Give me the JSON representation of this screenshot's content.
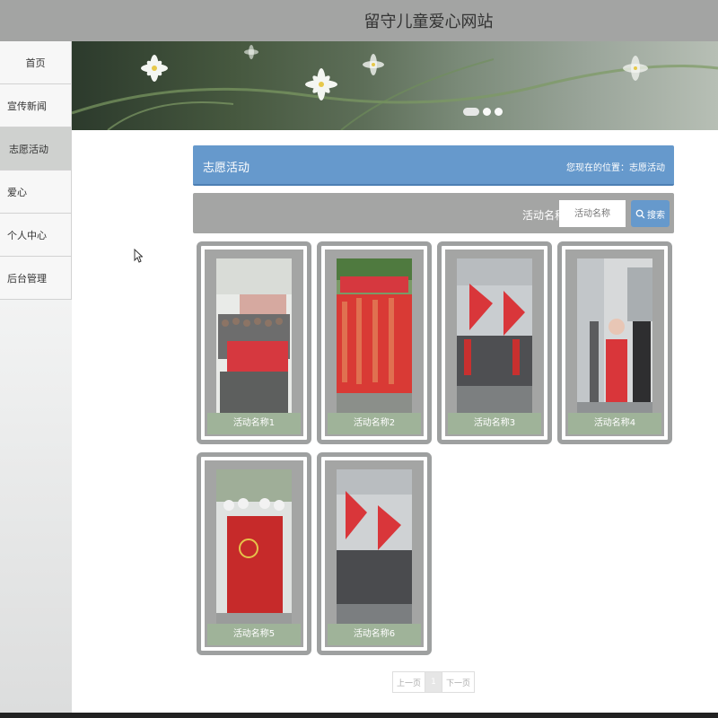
{
  "site": {
    "title": "留守儿童爱心网站"
  },
  "nav": {
    "items": [
      {
        "label": "首页"
      },
      {
        "label": "宣传新闻"
      },
      {
        "label": "志愿活动"
      },
      {
        "label": "爱心"
      },
      {
        "label": "个人中心"
      },
      {
        "label": "后台管理"
      }
    ]
  },
  "section": {
    "title": "志愿活动",
    "location": "您现在的位置：志愿活动"
  },
  "search": {
    "label": "活动名称",
    "placeholder": "活动名称",
    "button": "搜索"
  },
  "activities": [
    {
      "name": "活动名称1"
    },
    {
      "name": "活动名称2"
    },
    {
      "name": "活动名称3"
    },
    {
      "name": "活动名称4"
    },
    {
      "name": "活动名称5"
    },
    {
      "name": "活动名称6"
    }
  ],
  "pager": {
    "prev": "上一页",
    "current": "1",
    "next": "下一页"
  },
  "colors": {
    "accent": "#6699cc",
    "header": "#a3a4a3",
    "caption": "#9fb399"
  },
  "icons": {
    "search": "search-icon",
    "cursor": "mouse-cursor-icon"
  }
}
